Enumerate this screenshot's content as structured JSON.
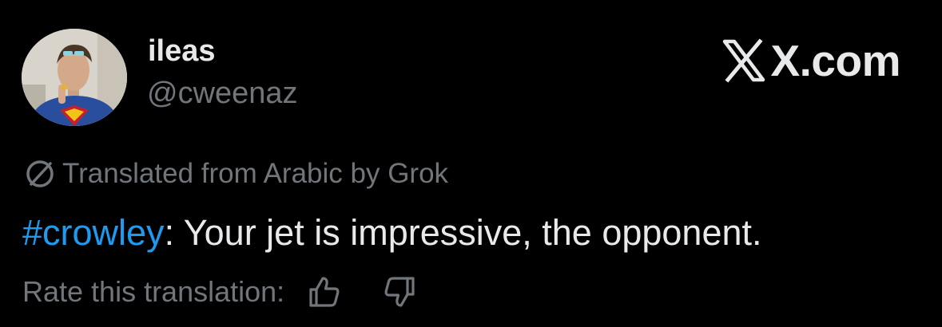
{
  "author": {
    "display_name": "ileas",
    "handle": "@cweenaz",
    "avatar": "avatar-photo"
  },
  "brand": {
    "logo_text": "X.com",
    "icon": "x-logo-icon"
  },
  "translation_notice": {
    "icon": "no-translation-icon",
    "text": "Translated from Arabic by Grok"
  },
  "tweet": {
    "hashtag": "#crowley",
    "body": ": Your jet is impressive, the opponent."
  },
  "rating": {
    "label": "Rate this translation:",
    "up_icon": "thumbs-up-icon",
    "down_icon": "thumbs-down-icon"
  },
  "colors": {
    "background": "#000000",
    "primary_text": "#e7e9ea",
    "secondary_text": "#71767b",
    "link": "#1d9bf0"
  }
}
